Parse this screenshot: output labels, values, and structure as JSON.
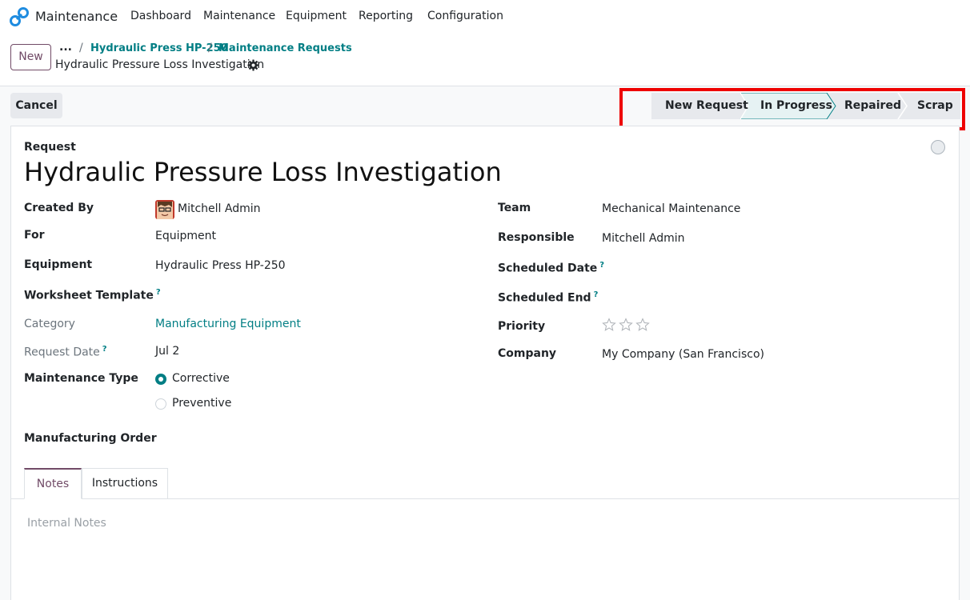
{
  "navbar": {
    "app_name": "Maintenance",
    "menu": [
      "Dashboard",
      "Maintenance",
      "Equipment",
      "Reporting",
      "Configuration"
    ]
  },
  "control_panel": {
    "new_label": "New",
    "breadcrumb_more": "...",
    "breadcrumbs": [
      "Hydraulic Press HP-250",
      "Maintenance Requests"
    ],
    "record_title": "Hydraulic Pressure Loss Investigation"
  },
  "actions": {
    "cancel_label": "Cancel"
  },
  "statusbar": {
    "stages": [
      "New Request",
      "In Progress",
      "Repaired",
      "Scrap"
    ],
    "active_stage": "In Progress"
  },
  "form": {
    "request_label": "Request",
    "title": "Hydraulic Pressure Loss Investigation",
    "left": {
      "created_by_label": "Created By",
      "created_by_value": "Mitchell Admin",
      "for_label": "For",
      "for_value": "Equipment",
      "equipment_label": "Equipment",
      "equipment_value": "Hydraulic Press HP-250",
      "worksheet_label": "Worksheet Template",
      "category_label": "Category",
      "category_value": "Manufacturing Equipment",
      "request_date_label": "Request Date",
      "request_date_value": "Jul 2",
      "maintenance_type_label": "Maintenance Type",
      "maintenance_type_options": [
        "Corrective",
        "Preventive"
      ],
      "maintenance_type_selected": "Corrective",
      "manufacturing_order_label": "Manufacturing Order"
    },
    "right": {
      "team_label": "Team",
      "team_value": "Mechanical Maintenance",
      "responsible_label": "Responsible",
      "responsible_value": "Mitchell Admin",
      "scheduled_date_label": "Scheduled Date",
      "scheduled_end_label": "Scheduled End",
      "priority_label": "Priority",
      "priority_stars_filled": 0,
      "priority_stars_total": 3,
      "company_label": "Company",
      "company_value": "My Company (San Francisco)"
    },
    "help_marker": "?"
  },
  "tabs": {
    "items": [
      "Notes",
      "Instructions"
    ],
    "active": "Notes",
    "notes_placeholder": "Internal Notes"
  },
  "colors": {
    "brand": "#714b67",
    "link": "#017e84",
    "highlight": "#ee0000"
  }
}
